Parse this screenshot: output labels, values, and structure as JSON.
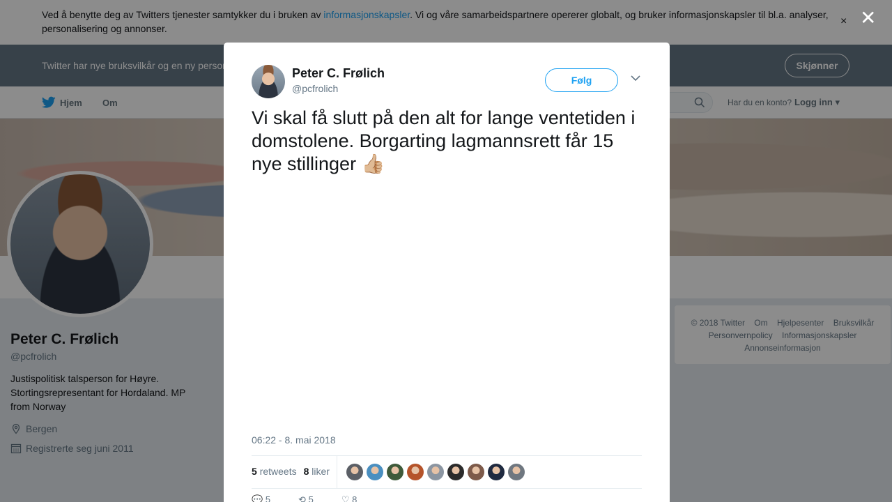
{
  "cookie": {
    "text_before": "Ved å benytte deg av Twitters tjenester samtykker du i bruken av ",
    "link": "informasjonskapsler",
    "text_after": ". Vi og våre samarbeidspartnere opererer globalt, og bruker informasjonskapsler til bl.a. analyser, personalisering og annonser."
  },
  "terms": {
    "text": "Twitter har nye bruksvilkår og en ny personvernpolicy",
    "button": "Skjønner"
  },
  "nav": {
    "home": "Hjem",
    "about": "Om",
    "account_prompt": "Har du en konto?",
    "login": "Logg inn"
  },
  "profile": {
    "name": "Peter C. Frølich",
    "handle": "@pcfrolich",
    "bio": "Justispolitisk talsperson for Høyre. Stortingsrepresentant for Hordaland. MP from Norway",
    "location": "Bergen",
    "joined": "Registrerte seg juni 2011"
  },
  "footer": {
    "links": [
      "© 2018 Twitter",
      "Om",
      "Hjelpesenter",
      "Bruksvilkår",
      "Personvernpolicy",
      "Informasjonskapsler",
      "Annonseinformasjon"
    ]
  },
  "tweet": {
    "author_name": "Peter C. Frølich",
    "author_handle": "@pcfrolich",
    "follow_label": "Følg",
    "text": "Vi skal få slutt på den alt for lange ventetiden i domstolene. Borgarting lagmannsrett får 15 nye stillinger",
    "emoji": "👍🏼",
    "timestamp": "06:22 - 8. mai 2018",
    "retweets_count": "5",
    "retweets_label": "retweets",
    "likes_count": "8",
    "likes_label": "liker",
    "liker_colors": [
      "#5b5f66",
      "#4a8fc0",
      "#3e5a3a",
      "#b5532a",
      "#8b95a1",
      "#2b2b2b",
      "#7d5a4a",
      "#1f2a40",
      "#6f7780"
    ],
    "reply_count": "5",
    "retweet_action_count": "5",
    "like_action_count": "8"
  }
}
